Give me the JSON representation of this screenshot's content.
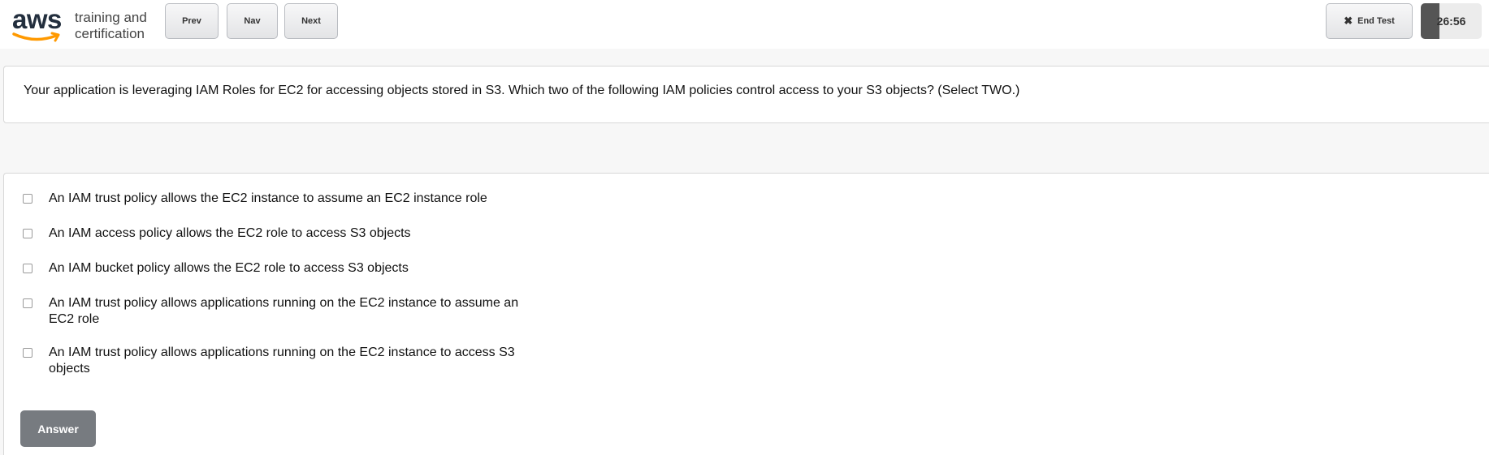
{
  "header": {
    "logo": {
      "brand": "aws",
      "line1": "training and",
      "line2": "certification"
    },
    "prev_label": "Prev",
    "nav_label": "Nav",
    "next_label": "Next",
    "end_test_label": "End Test",
    "timer": "26:56"
  },
  "question": {
    "text": "Your application is leveraging IAM Roles for EC2 for accessing objects stored in S3.  Which two of the following IAM policies control access to your S3 objects? (Select TWO.)"
  },
  "options": [
    {
      "label": "An IAM trust policy allows the EC2 instance to assume an EC2 instance role",
      "checked": false
    },
    {
      "label": "An IAM access policy allows the EC2 role to access S3 objects",
      "checked": false
    },
    {
      "label": "An IAM bucket policy allows the EC2 role to access S3 objects",
      "checked": false
    },
    {
      "label": "An IAM trust policy allows applications running on the EC2 instance to assume an EC2 role",
      "checked": false
    },
    {
      "label": "An IAM trust policy allows applications running on the EC2 instance to access S3 objects",
      "checked": false
    }
  ],
  "answer_button_label": "Answer",
  "colors": {
    "brand_text": "#232f3e",
    "brand_smile": "#ff9900",
    "answer_button": "#777b80"
  }
}
